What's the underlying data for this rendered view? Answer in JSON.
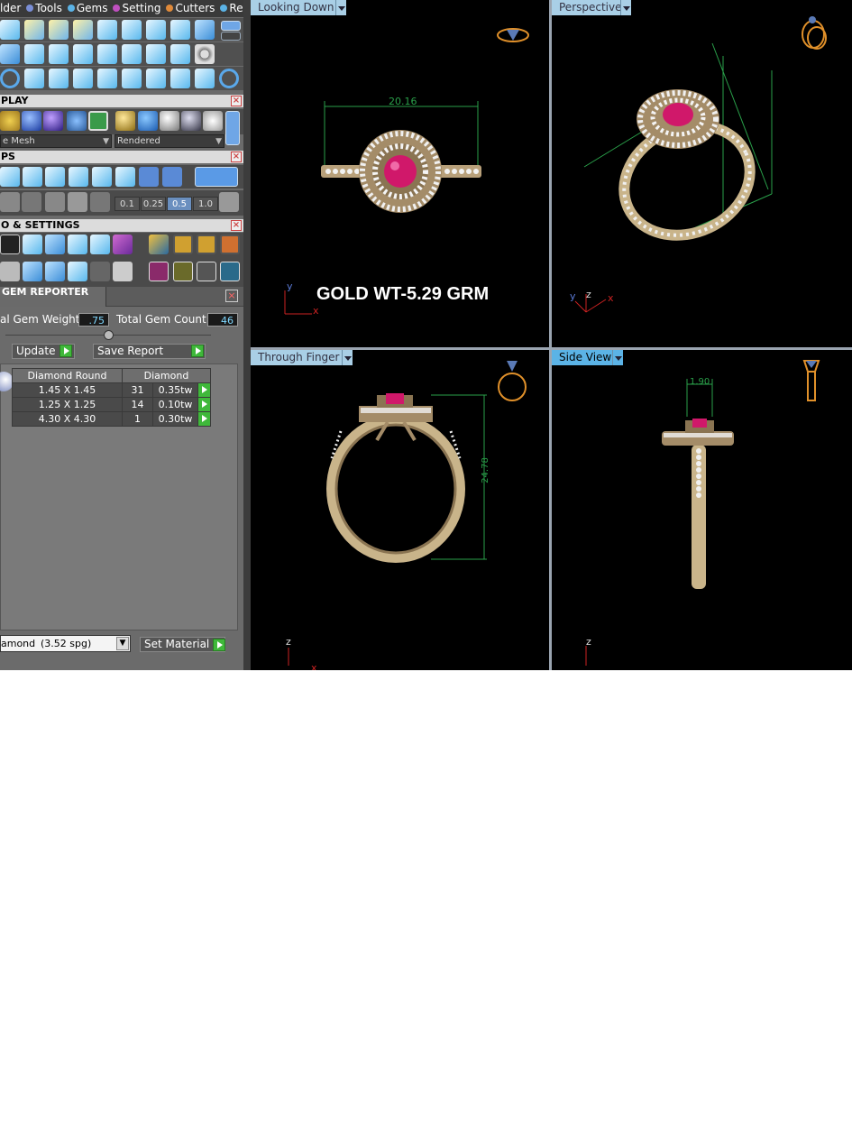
{
  "menu": {
    "items": [
      {
        "label": "lder",
        "dot": "#7a8ed6"
      },
      {
        "label": "Tools",
        "dot": "#5bb3e6"
      },
      {
        "label": "Gems",
        "dot": "#c050c0"
      },
      {
        "label": "Setting",
        "dot": "#e08a3a"
      },
      {
        "label": "Cutters",
        "dot": "#5bb3e6"
      },
      {
        "label": "Render",
        "dot": ""
      }
    ]
  },
  "sections": {
    "display": "PLAY",
    "snaps": "PS",
    "settings": "O & SETTINGS"
  },
  "display": {
    "mesh_dropdown": "e Mesh",
    "render_dropdown": "Rendered"
  },
  "snap_values": [
    "0.1",
    "0.25",
    "0.5",
    "1.0"
  ],
  "gem_reporter": {
    "title": "GEM REPORTER",
    "total_weight_label": "al Gem Weight",
    "total_weight_value": ".75",
    "total_count_label": "Total Gem Count",
    "total_count_value": "46",
    "update_label": "Update",
    "save_report_label": "Save Report",
    "table": {
      "headers": [
        "Diamond Round",
        "Diamond"
      ],
      "rows": [
        {
          "size": "1.45 X 1.45",
          "count": "31",
          "weight": "0.35tw"
        },
        {
          "size": "1.25 X 1.25",
          "count": "14",
          "weight": "0.10tw"
        },
        {
          "size": "4.30 X 4.30",
          "count": "1",
          "weight": "0.30tw"
        }
      ]
    },
    "material_value": "amond",
    "material_spg": "(3.52 spg)",
    "set_material_label": "Set Material"
  },
  "viewports": {
    "top_left": {
      "label": "Looking Down",
      "dimension": "20.16",
      "annotation": "GOLD WT-5.29 GRM"
    },
    "top_right": {
      "label": "Perspective"
    },
    "bottom_left": {
      "label": "Through Finger",
      "dimension": "24.78"
    },
    "bottom_right": {
      "label": "Side View",
      "dimension": "1.90"
    }
  },
  "axes": {
    "x": "x",
    "y": "y",
    "z": "z"
  },
  "colors": {
    "gold": "#c9b48a",
    "ruby": "#d0186a",
    "dim_line": "#2aa04a",
    "viewport_bg": "#000000",
    "active_tab": "#5bb3e6"
  }
}
